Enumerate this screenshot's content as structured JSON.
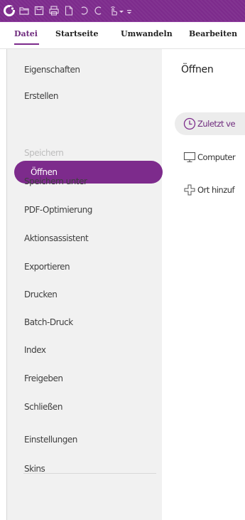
{
  "colors": {
    "accent": "#7d2b8c",
    "toolbar": "#7d2b8c",
    "sidebar_bg": "#f1f1f1",
    "selected_text": "#ffffff"
  },
  "quick_access": {
    "icons": [
      "app-logo-icon",
      "open-folder-icon",
      "save-icon",
      "print-icon",
      "new-doc-icon",
      "undo-icon",
      "redo-icon",
      "hand-tool-icon",
      "customize-toolbar-icon"
    ]
  },
  "ribbon": {
    "tabs": [
      {
        "label": "Datei",
        "active": true
      },
      {
        "label": "Startseite",
        "active": false
      },
      {
        "label": "Umwandeln",
        "active": false
      },
      {
        "label": "Bearbeiten",
        "active": false
      }
    ]
  },
  "sidebar": {
    "items": [
      {
        "label": "Eigenschaften",
        "state": "normal"
      },
      {
        "label": "Erstellen",
        "state": "normal"
      },
      {
        "label": "Öffnen",
        "state": "selected"
      },
      {
        "label": "Speichern",
        "state": "disabled"
      },
      {
        "label": "Speichern unter",
        "state": "normal"
      },
      {
        "label": "PDF-Optimierung",
        "state": "normal"
      },
      {
        "label": "Aktionsassistent",
        "state": "normal"
      },
      {
        "label": "Exportieren",
        "state": "normal"
      },
      {
        "label": "Drucken",
        "state": "normal"
      },
      {
        "label": "Batch-Druck",
        "state": "normal"
      },
      {
        "label": "Index",
        "state": "normal"
      },
      {
        "label": "Freigeben",
        "state": "normal"
      },
      {
        "label": "Schließen",
        "state": "normal"
      },
      {
        "label": "Einstellungen",
        "state": "normal"
      },
      {
        "label": "Skins",
        "state": "normal"
      }
    ]
  },
  "content": {
    "title": "Öffnen",
    "options": [
      {
        "label": "Zuletzt ve",
        "icon": "clock-icon",
        "selected": true
      },
      {
        "label": "Computer",
        "icon": "monitor-icon",
        "selected": false
      },
      {
        "label": "Ort hinzuf",
        "icon": "plus-icon",
        "selected": false
      }
    ]
  }
}
